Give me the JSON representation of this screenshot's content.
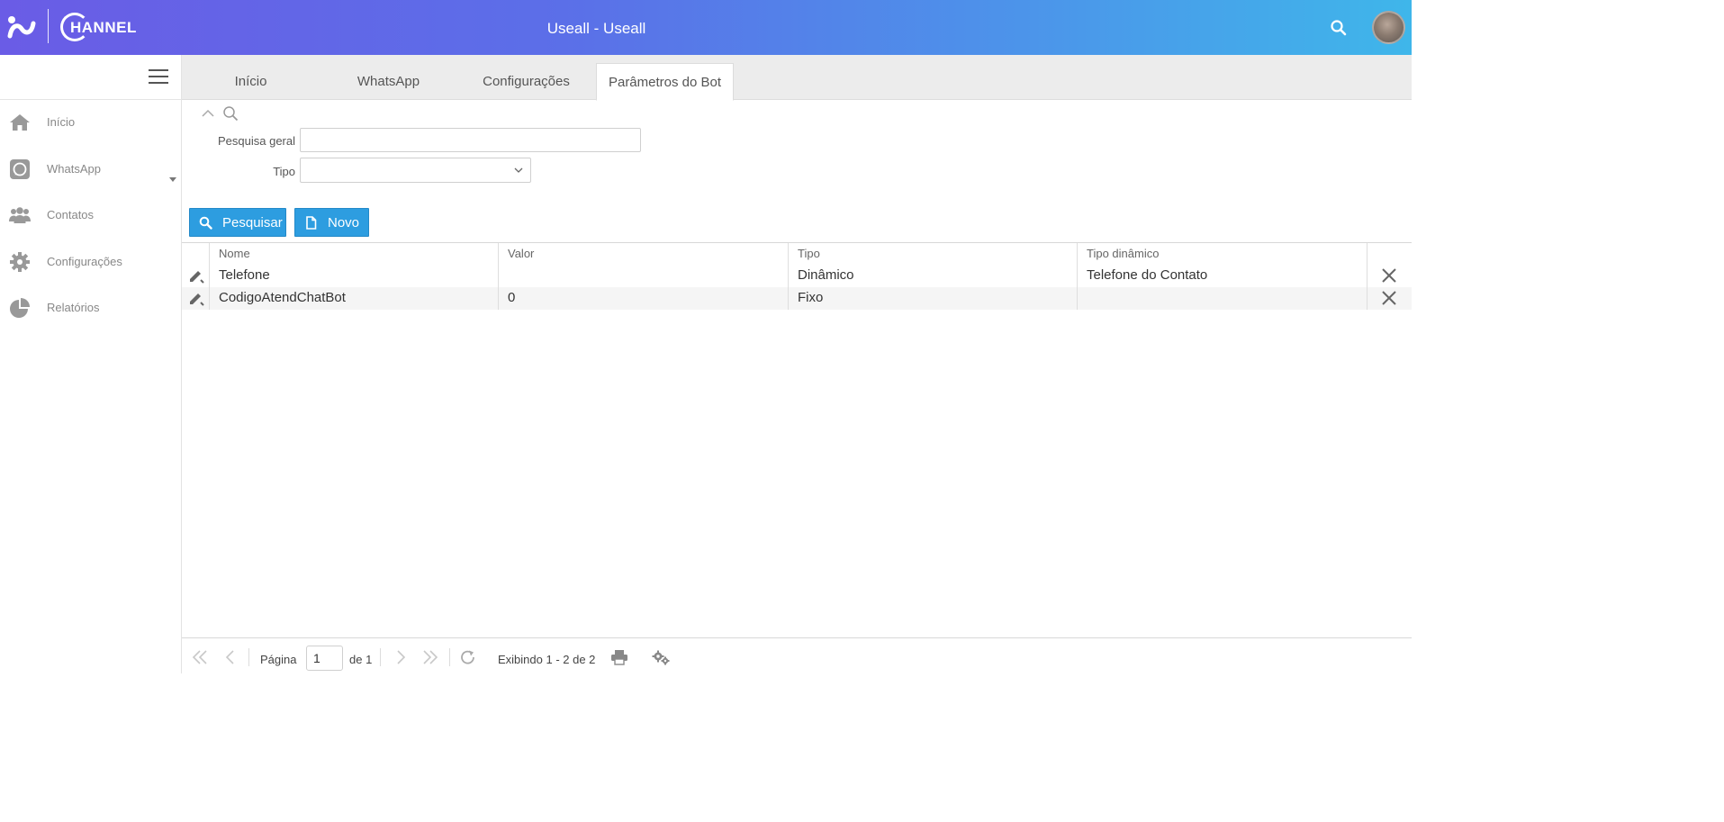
{
  "header": {
    "title": "Useall - Useall",
    "logo_word": "HANNEL",
    "search_icon": "search-icon",
    "avatar": "user-avatar"
  },
  "sidebar": {
    "menu_icon": "hamburger-icon",
    "items": [
      {
        "label": "Início",
        "icon": "home-icon"
      },
      {
        "label": "WhatsApp",
        "icon": "whatsapp-icon"
      },
      {
        "label": "Contatos",
        "icon": "users-icon"
      },
      {
        "label": "Configurações",
        "icon": "gear-icon"
      },
      {
        "label": "Relatórios",
        "icon": "pie-chart-icon"
      }
    ]
  },
  "tabs": [
    {
      "label": "Início"
    },
    {
      "label": "WhatsApp"
    },
    {
      "label": "Configurações"
    },
    {
      "label": "Parâmetros do Bot",
      "active": true
    }
  ],
  "filters": {
    "search_label": "Pesquisa geral",
    "search_value": "",
    "tipo_label": "Tipo",
    "tipo_value": ""
  },
  "buttons": {
    "search": "Pesquisar",
    "new": "Novo"
  },
  "table": {
    "columns": [
      "Nome",
      "Valor",
      "Tipo",
      "Tipo dinâmico"
    ],
    "rows": [
      {
        "nome": "Telefone",
        "valor": "",
        "tipo": "Dinâmico",
        "tipo_dinamico": "Telefone do Contato"
      },
      {
        "nome": "CodigoAtendChatBot",
        "valor": "0",
        "tipo": "Fixo",
        "tipo_dinamico": ""
      }
    ]
  },
  "pager": {
    "page_label": "Página",
    "page_value": "1",
    "of_label": "de 1",
    "display_text": "Exibindo 1 - 2 de 2"
  },
  "colors": {
    "accent": "#2d9de0",
    "header_start": "#6a5ce6",
    "header_end": "#3fb6ea"
  }
}
